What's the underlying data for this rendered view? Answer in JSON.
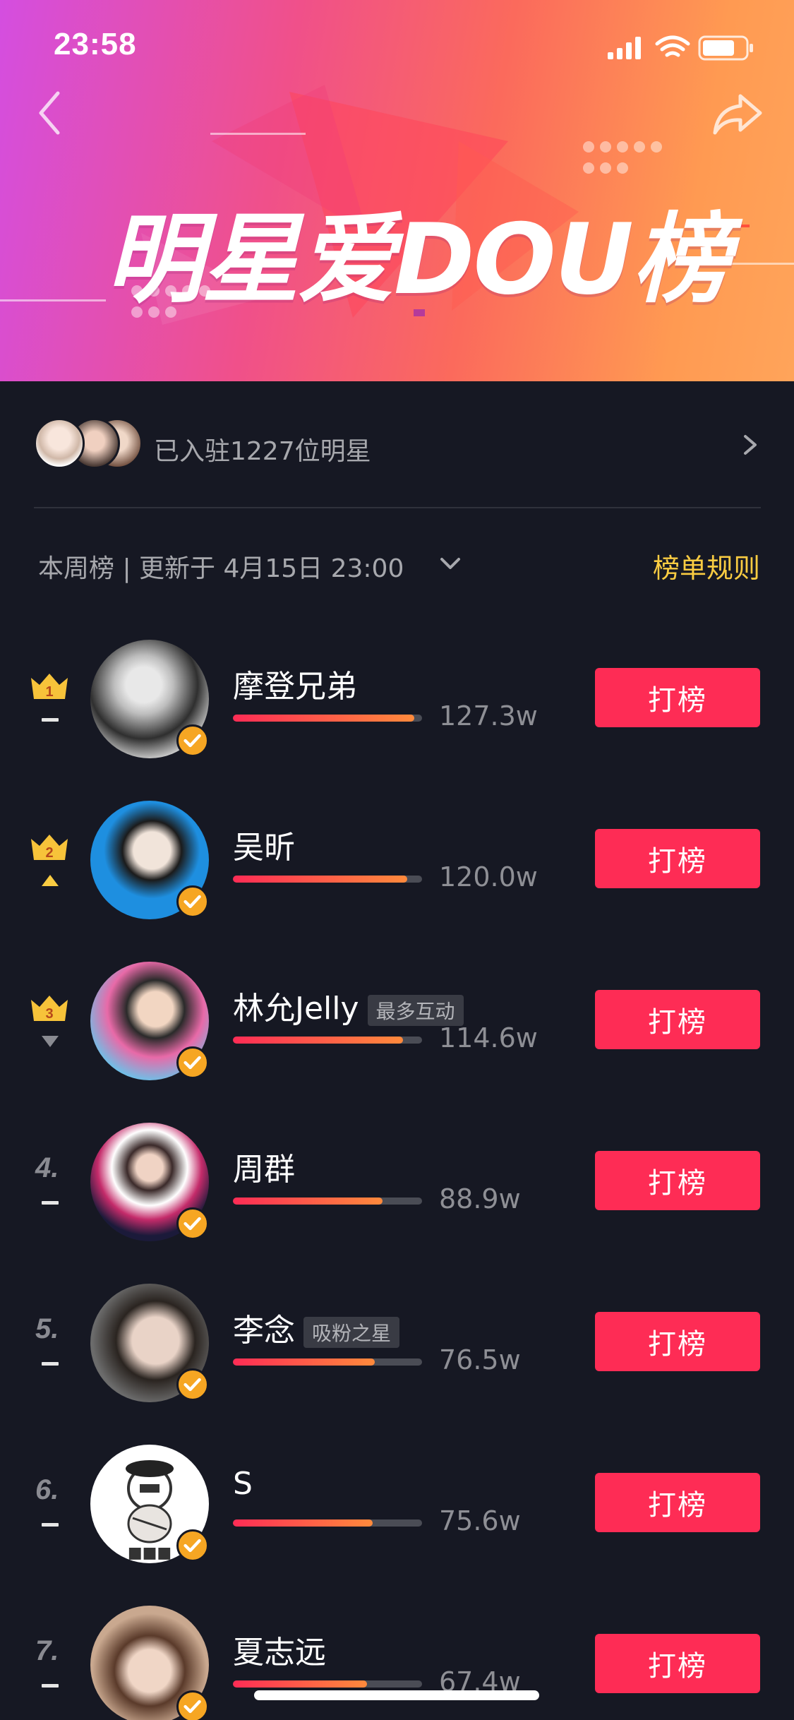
{
  "status_bar": {
    "time": "23:58"
  },
  "banner": {
    "title": "明星爱DOU榜"
  },
  "stars": {
    "text": "已入驻1227位明星"
  },
  "week": {
    "label": "本周榜 | 更新于 4月15日 23:00",
    "rules": "榜单规则"
  },
  "colors": {
    "accent": "#fe2c55",
    "rules": "#facc42",
    "background": "#161823"
  },
  "list": [
    {
      "rank": "1",
      "trend": "flat",
      "name": "摩登兄弟",
      "tag": "",
      "score": "127.3w",
      "progress": 0.96,
      "button": "打榜",
      "avatar_colors": [
        "#d9d9d9",
        "#3a3a3a"
      ]
    },
    {
      "rank": "2",
      "trend": "up",
      "name": "吴昕",
      "tag": "",
      "score": "120.0w",
      "progress": 0.92,
      "button": "打榜",
      "avatar_colors": [
        "#1e8fe0",
        "#f1e4da"
      ]
    },
    {
      "rank": "3",
      "trend": "down",
      "name": "林允Jelly",
      "tag": "最多互动",
      "score": "114.6w",
      "progress": 0.9,
      "button": "打榜",
      "avatar_colors": [
        "#e86aa8",
        "#f2d6c2"
      ]
    },
    {
      "rank": "4.",
      "trend": "flat",
      "name": "周群",
      "tag": "",
      "score": "88.9w",
      "progress": 0.79,
      "button": "打榜",
      "avatar_colors": [
        "#1b1a3a",
        "#f0d3c4"
      ]
    },
    {
      "rank": "5.",
      "trend": "flat",
      "name": "李念",
      "tag": "吸粉之星",
      "score": "76.5w",
      "progress": 0.75,
      "button": "打榜",
      "avatar_colors": [
        "#6b6b6b",
        "#e9d3c7"
      ]
    },
    {
      "rank": "6.",
      "trend": "flat",
      "name": "S",
      "tag": "",
      "score": "75.6w",
      "progress": 0.74,
      "button": "打榜",
      "avatar_colors": [
        "#ffffff",
        "#333333"
      ]
    },
    {
      "rank": "7.",
      "trend": "flat",
      "name": "夏志远",
      "tag": "",
      "score": "67.4w",
      "progress": 0.71,
      "button": "打榜",
      "avatar_colors": [
        "#c9a88f",
        "#f0d6c6"
      ]
    }
  ]
}
